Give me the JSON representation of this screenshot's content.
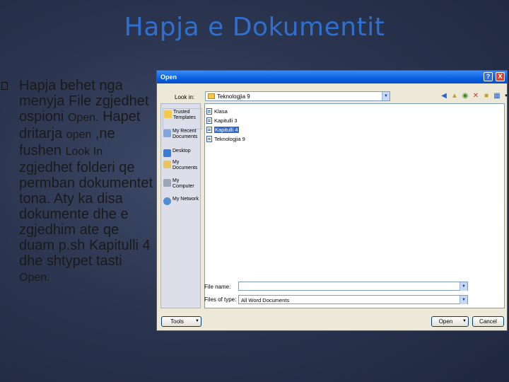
{
  "slide": {
    "title": "Hapja e Dokumentit",
    "bullet": {
      "part1": "Hapja behet nga menyja File zgjedhet ospioni ",
      "open1": "Open.",
      "part2": " Hapet dritarja ",
      "open2": "open",
      "part3": " ,ne fushen ",
      "lookin": "Look In",
      "part4": " zgjedhet folderi qe permban dokumentet tona. Aty ka disa dokumente dhe e zgjedhim ate qe duam p.sh Kapitulli 4 dhe shtypet tasti ",
      "open3": "Open."
    }
  },
  "dialog": {
    "title": "Open",
    "help": "?",
    "close": "X",
    "look_in_label": "Look in:",
    "look_in_value": "Teknologjia 9",
    "places": [
      {
        "label": "Trusted Templates",
        "icon": "folder-icon"
      },
      {
        "label": "My Recent Documents",
        "icon": "recent-documents-icon"
      },
      {
        "label": "Desktop",
        "icon": "desktop-icon"
      },
      {
        "label": "My Documents",
        "icon": "my-documents-icon"
      },
      {
        "label": "My Computer",
        "icon": "my-computer-icon"
      },
      {
        "label": "My Network",
        "icon": "network-icon"
      }
    ],
    "files": [
      {
        "name": "Klasa"
      },
      {
        "name": "Kapitulli 3"
      },
      {
        "name": "Kapitulli 4"
      },
      {
        "name": "Teknologjia 9"
      }
    ],
    "file_name_label": "File name:",
    "file_name_value": "",
    "files_of_type_label": "Files of type:",
    "files_of_type_value": "All Word Documents",
    "tools_label": "Tools",
    "open_label": "Open",
    "cancel_label": "Cancel"
  },
  "colors": {
    "title": "#2e6fd0",
    "titlebar": "#0a5fe0",
    "selection": "#316ac5"
  }
}
